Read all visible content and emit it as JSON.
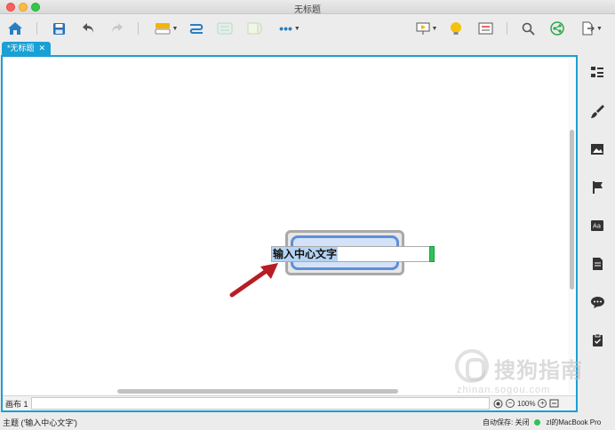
{
  "window": {
    "title": "无标题"
  },
  "tab": {
    "label": "*无标题",
    "close": "✕"
  },
  "topic": {
    "text": "输入中心文字"
  },
  "sheet": {
    "label": "画布 1"
  },
  "zoom": {
    "level": "100%"
  },
  "status": {
    "left": "主题 ('输入中心文字')",
    "autosave": "自动保存: 关闭",
    "user": "zl的MacBook Pro"
  },
  "watermark": {
    "text": "搜狗指南",
    "url": "zhinan.sogou.com"
  },
  "colors": {
    "accent": "#1aa0d4",
    "topic_border": "#5d8fd8",
    "topic_fill": "#d3e2f8",
    "arrow": "#b81c24"
  }
}
